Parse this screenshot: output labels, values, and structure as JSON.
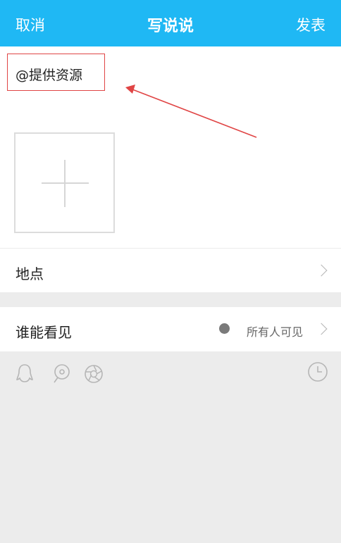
{
  "header": {
    "cancel_label": "取消",
    "title": "写说说",
    "publish_label": "发表"
  },
  "compose": {
    "text": "@提供资源"
  },
  "location": {
    "label": "地点"
  },
  "visibility": {
    "label": "谁能看见",
    "value": "所有人可见"
  },
  "toolbar": {
    "icons": [
      "qq-penguin-icon",
      "location-pin-icon",
      "camera-shutter-icon",
      "clock-icon"
    ]
  },
  "colors": {
    "header_bg": "#1fb8f4",
    "annotation_red": "#e04545",
    "page_bg": "#ececec"
  }
}
